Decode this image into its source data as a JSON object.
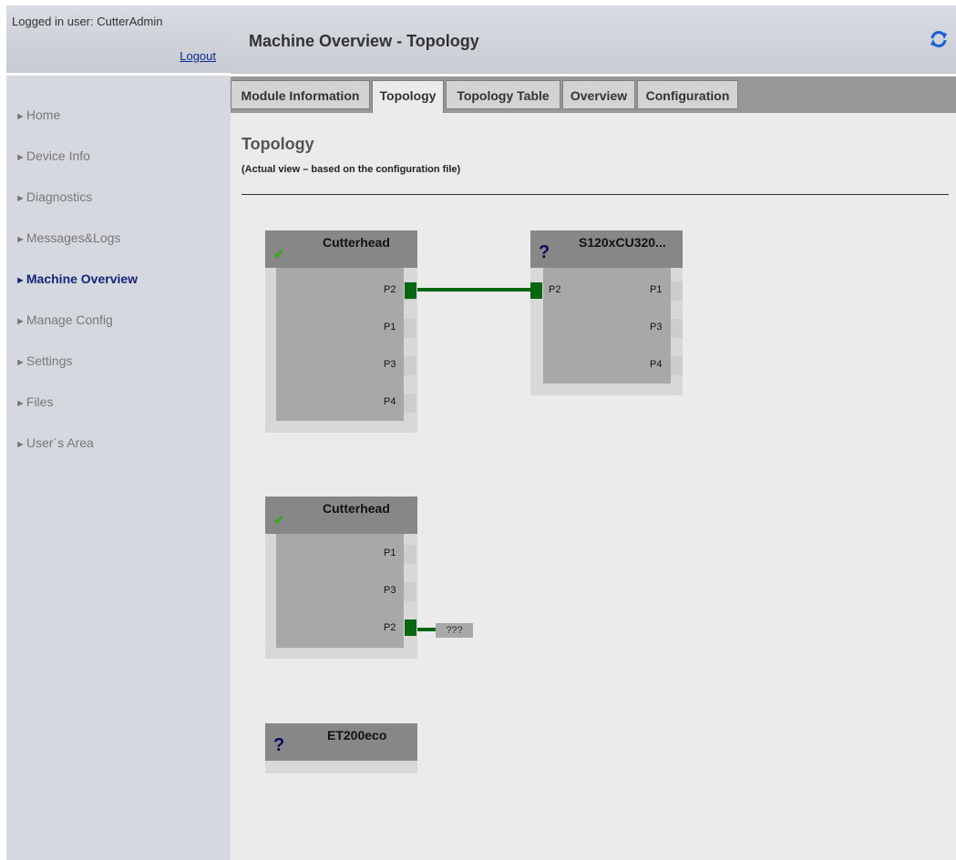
{
  "login": {
    "user_text": "Logged in user: CutterAdmin",
    "logout_label": "Logout"
  },
  "nav": {
    "items": [
      {
        "label": "Home"
      },
      {
        "label": "Device Info"
      },
      {
        "label": "Diagnostics"
      },
      {
        "label": "Messages&Logs"
      },
      {
        "label": "Machine Overview"
      },
      {
        "label": "Manage Config"
      },
      {
        "label": "Settings"
      },
      {
        "label": "Files"
      },
      {
        "label": "User´s Area"
      }
    ],
    "arrow": "►",
    "active_index": 4
  },
  "header": {
    "title": "Machine Overview - Topology",
    "refresh_icon": "refresh-icon"
  },
  "tabs": [
    {
      "label": "Module Information"
    },
    {
      "label": "Topology"
    },
    {
      "label": "Topology Table"
    },
    {
      "label": "Overview"
    },
    {
      "label": "Configuration"
    }
  ],
  "active_tab": "Topology",
  "section": {
    "title": "Topology",
    "subtitle": "(Actual view – based on the configuration file)"
  },
  "modules": {
    "cutterhead1": {
      "name": "Cutterhead",
      "status": "ok",
      "status_icon": "checkmark-icon",
      "check": "✔",
      "ports": [
        "P2",
        "P1",
        "P3",
        "P4"
      ]
    },
    "s120": {
      "name": "S120xCU320...",
      "status": "unknown",
      "status_icon": "question-icon",
      "mark": "?",
      "ports": [
        "P2",
        "P1",
        "P3",
        "P4"
      ]
    },
    "cutterhead2": {
      "name": "Cutterhead",
      "status": "ok",
      "status_icon": "checkmark-icon",
      "check": "✔",
      "ports": [
        "P1",
        "P3",
        "P2"
      ],
      "unknown_link": "???"
    },
    "et200": {
      "name": "ET200eco",
      "status": "unknown",
      "status_icon": "question-icon",
      "mark": "?"
    }
  },
  "colors": {
    "connection": "#0b6612",
    "active_nav": "#16237a",
    "ok_check": "#3aa61e",
    "unknown_mark": "#0b0b5c"
  }
}
